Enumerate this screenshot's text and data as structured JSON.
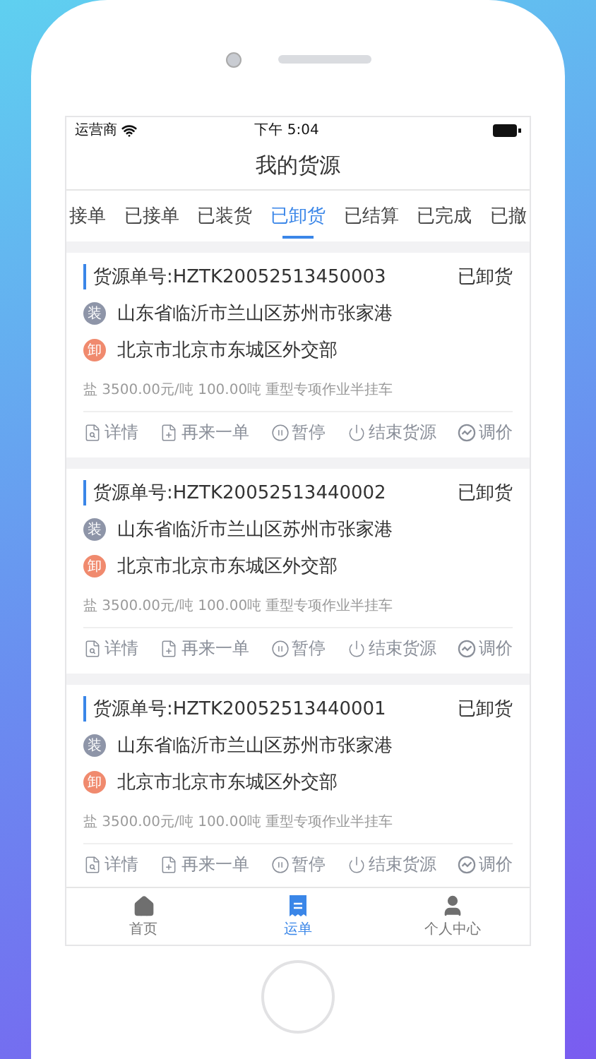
{
  "status_bar": {
    "carrier": "运营商",
    "time": "下午 5:04"
  },
  "title": "我的货源",
  "tabs": [
    {
      "label": "接单",
      "selected": false
    },
    {
      "label": "已接单",
      "selected": false
    },
    {
      "label": "已装货",
      "selected": false
    },
    {
      "label": "已卸货",
      "selected": true
    },
    {
      "label": "已结算",
      "selected": false
    },
    {
      "label": "已完成",
      "selected": false
    },
    {
      "label": "已撤",
      "selected": false
    }
  ],
  "orders": [
    {
      "number": "货源单号:HZTK20052513450003",
      "status": "已卸货",
      "load_badge": "装",
      "origin": "山东省临沂市兰山区苏州市张家港",
      "unload_badge": "卸",
      "destination": "北京市北京市东城区外交部",
      "details": "盐 3500.00元/吨 100.00吨 重型专项作业半挂车",
      "actions": [
        {
          "kind": "details",
          "label": "详情"
        },
        {
          "kind": "again",
          "label": "再来一单"
        },
        {
          "kind": "pause",
          "label": "暂停"
        },
        {
          "kind": "end",
          "label": "结束货源"
        },
        {
          "kind": "price",
          "label": "调价"
        }
      ]
    },
    {
      "number": "货源单号:HZTK20052513440002",
      "status": "已卸货",
      "load_badge": "装",
      "origin": "山东省临沂市兰山区苏州市张家港",
      "unload_badge": "卸",
      "destination": "北京市北京市东城区外交部",
      "details": "盐 3500.00元/吨 100.00吨 重型专项作业半挂车",
      "actions": [
        {
          "kind": "details",
          "label": "详情"
        },
        {
          "kind": "again",
          "label": "再来一单"
        },
        {
          "kind": "pause",
          "label": "暂停"
        },
        {
          "kind": "end",
          "label": "结束货源"
        },
        {
          "kind": "price",
          "label": "调价"
        }
      ]
    },
    {
      "number": "货源单号:HZTK20052513440001",
      "status": "已卸货",
      "load_badge": "装",
      "origin": "山东省临沂市兰山区苏州市张家港",
      "unload_badge": "卸",
      "destination": "北京市北京市东城区外交部",
      "details": "盐 3500.00元/吨 100.00吨 重型专项作业半挂车",
      "actions": [
        {
          "kind": "details",
          "label": "详情"
        },
        {
          "kind": "again",
          "label": "再来一单"
        },
        {
          "kind": "pause",
          "label": "暂停"
        },
        {
          "kind": "end",
          "label": "结束货源"
        },
        {
          "kind": "price",
          "label": "调价"
        }
      ]
    }
  ],
  "nav": [
    {
      "kind": "home",
      "label": "首页",
      "selected": false
    },
    {
      "kind": "orders",
      "label": "运单",
      "selected": true
    },
    {
      "kind": "profile",
      "label": "个人中心",
      "selected": false
    }
  ]
}
